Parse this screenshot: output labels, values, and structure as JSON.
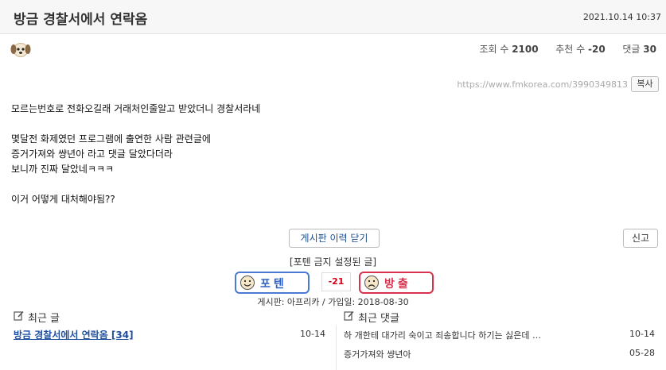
{
  "post": {
    "title": "방금 경찰서에서 연락옴",
    "datetime": "2021.10.14 10:37",
    "stats": {
      "views_label": "조회 수",
      "views": "2100",
      "recommend_label": "추천 수",
      "recommend": "-20",
      "comments_label": "댓글",
      "comments": "30"
    },
    "url": "https://www.fmkorea.com/3990349813",
    "copy_button": "복사",
    "content_lines": [
      "모르는번호로 전화오길래 거래처인줄알고 받았더니 경찰서라네",
      "",
      "몇달전 화제였던 프로그램에 출연한 사람 관련글에",
      "증거가져와 썅년아 라고 댓글 달았다더라",
      "보니까 진짜 달았네ㅋㅋㅋ",
      "",
      "이거 어떻게 대처해야됨??"
    ]
  },
  "actions": {
    "history_button": "게시판 이력 닫기",
    "report_button": "신고",
    "potent_note": "[포텐 금지 설정된 글]",
    "upvote_label": "포텐",
    "vote_count": "-21",
    "downvote_label": "방출",
    "board_info": "게시판: 아프리카 / 가입일: 2018-08-30"
  },
  "recent_posts": {
    "heading": "최근 글",
    "items": [
      {
        "title": "방금 경찰서에서 연락옴 [34]",
        "date": "10-14"
      }
    ]
  },
  "recent_comments": {
    "heading": "최근 댓글",
    "items": [
      {
        "text": "하 개한테 대가리 숙이고 죄송합니다 하기는 싫은데 …",
        "date": "10-14"
      },
      {
        "text": "증거가져와 썅년아",
        "date": "05-28"
      }
    ]
  },
  "colors": {
    "link": "#1f4f9f",
    "upvote": "#2d63c8",
    "downvote": "#d8324e",
    "vote_count": "#d0021b"
  }
}
